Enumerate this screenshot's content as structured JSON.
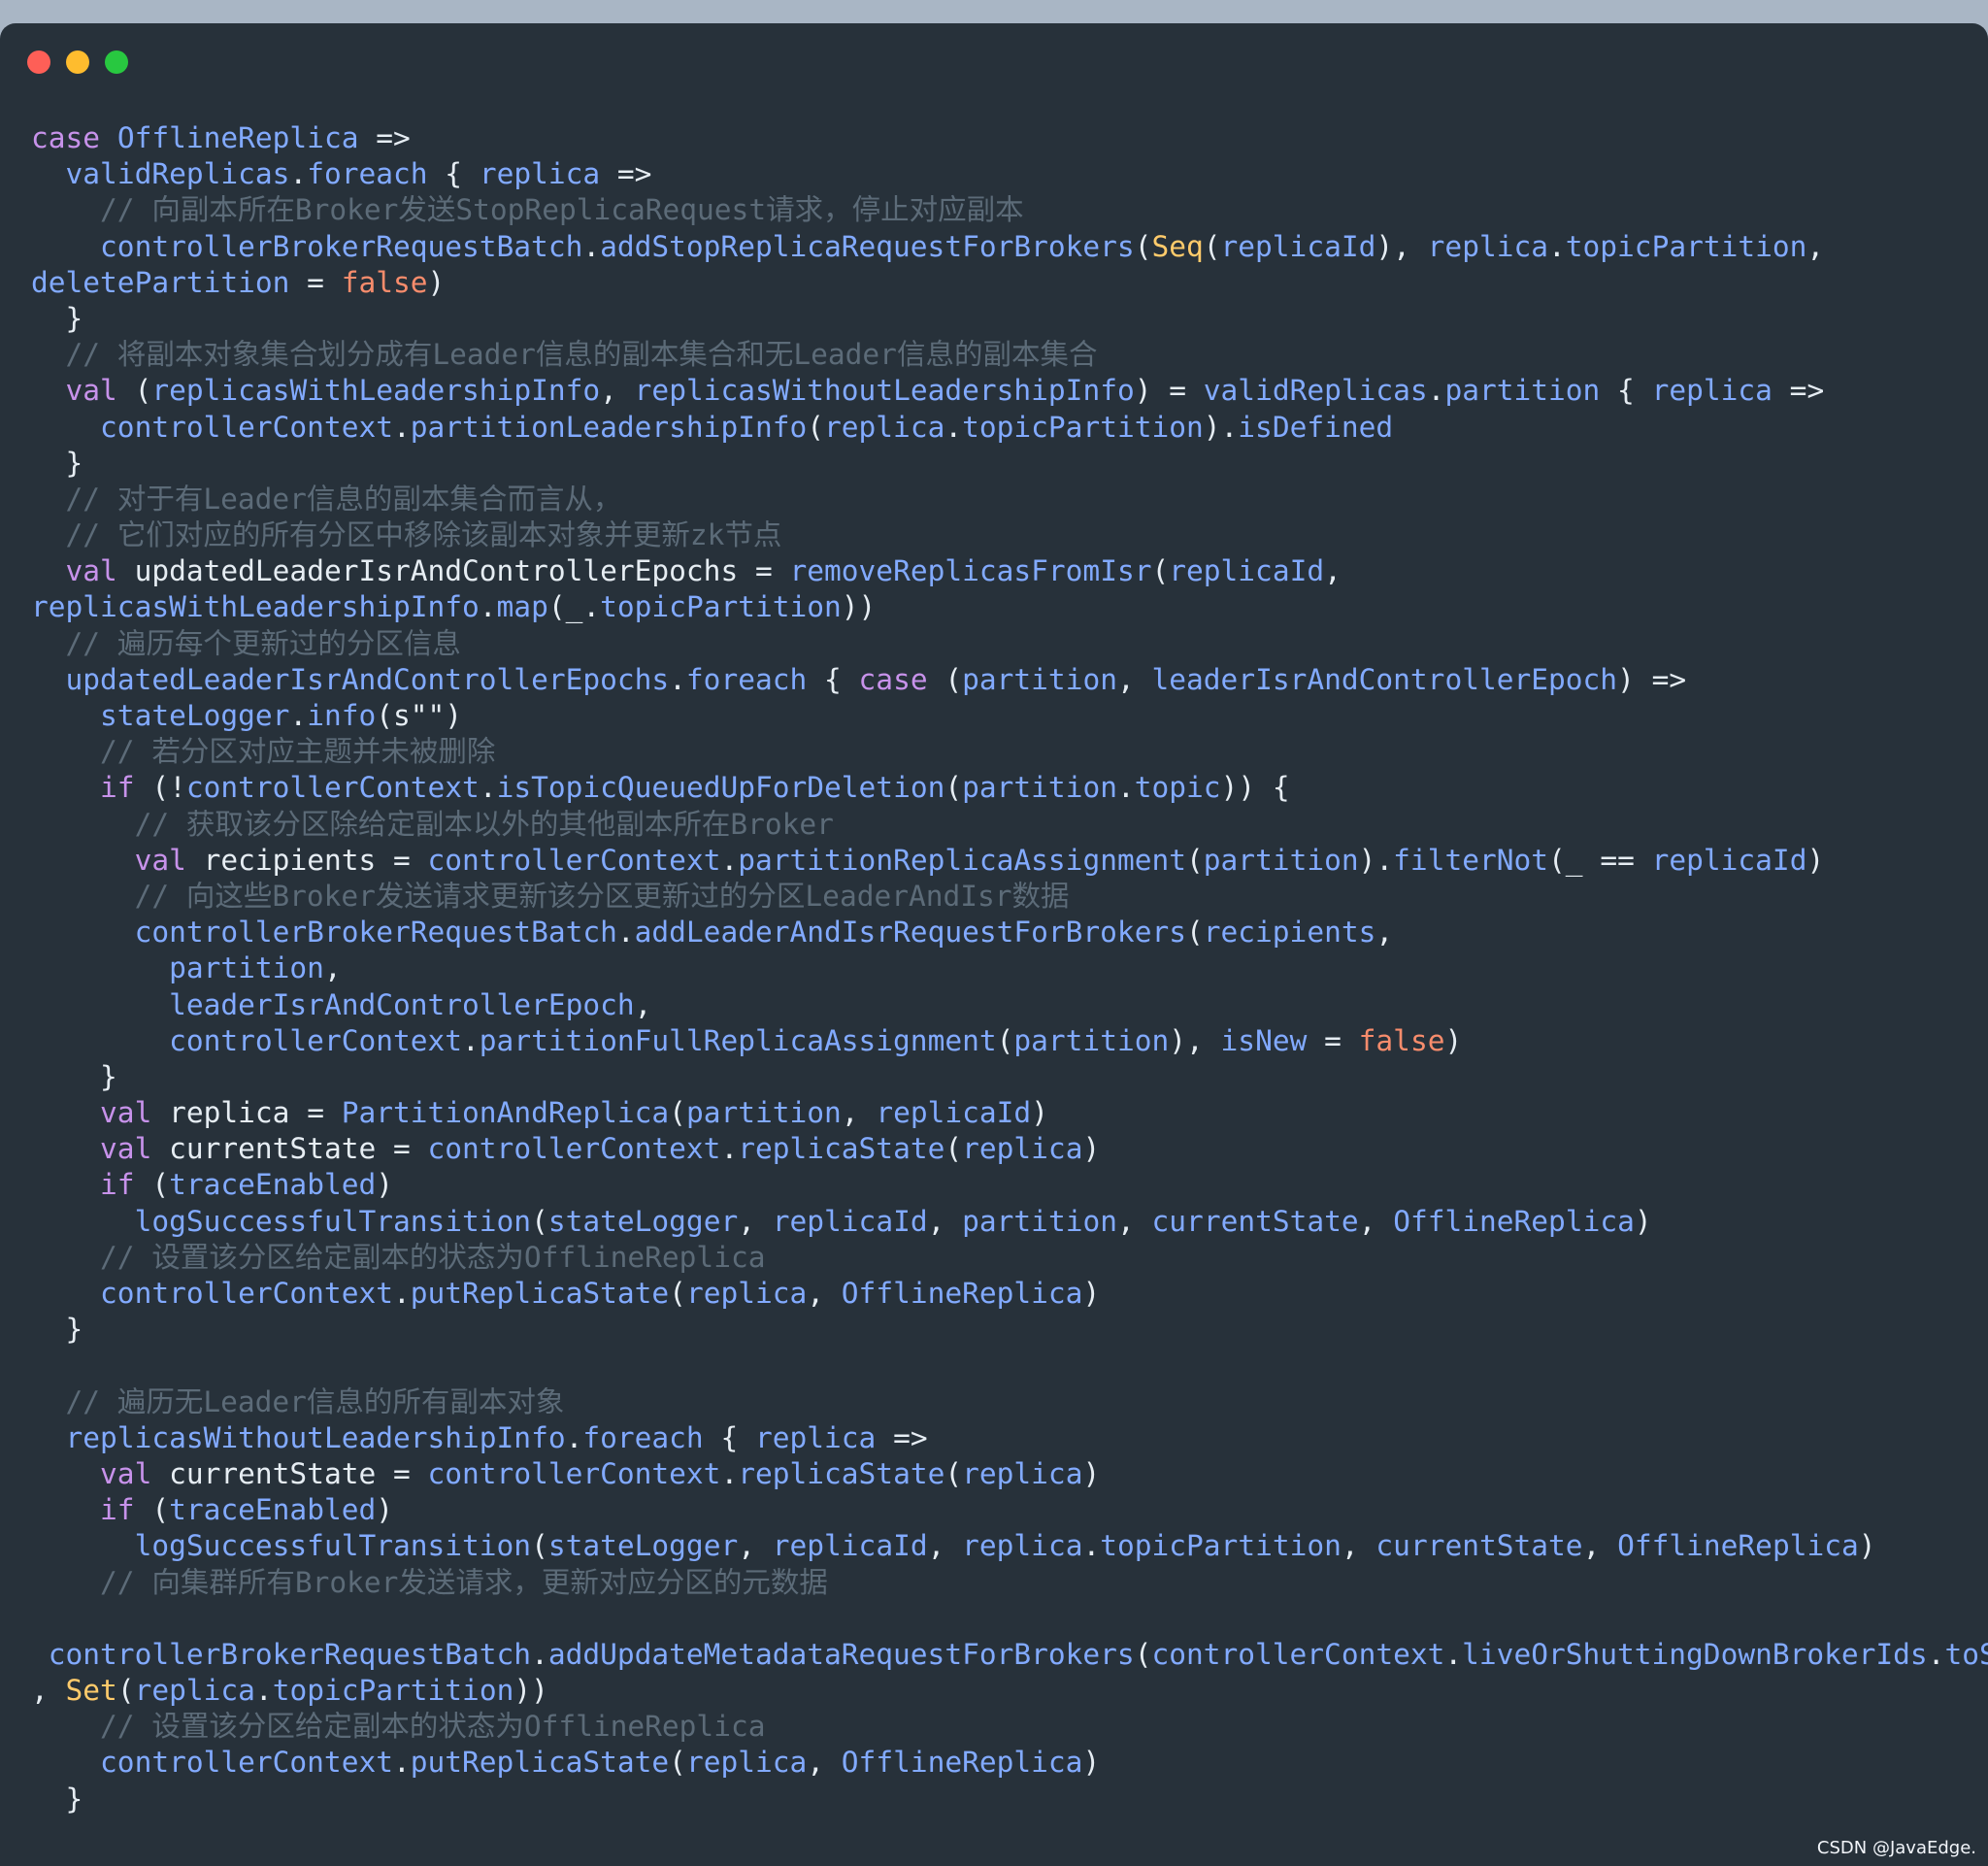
{
  "colors": {
    "plain": "#e6edf3",
    "keyword": "#c792ea",
    "ident": "#82aaff",
    "comment": "#5c6b78",
    "bool": "#f78c6c",
    "type": "#ffcb6b"
  },
  "window": {
    "controls": [
      {
        "name": "close-button",
        "color": "#fe5f57"
      },
      {
        "name": "minimize-button",
        "color": "#febc2e"
      },
      {
        "name": "maximize-button",
        "color": "#28c840"
      }
    ]
  },
  "code": {
    "lines": [
      [
        [
          "k",
          "case "
        ],
        [
          "i",
          "OfflineReplica"
        ],
        [
          "p",
          " =>"
        ]
      ],
      [
        [
          "p",
          "  "
        ],
        [
          "i",
          "validReplicas"
        ],
        [
          "p",
          "."
        ],
        [
          "i",
          "foreach"
        ],
        [
          "p",
          " { "
        ],
        [
          "i",
          "replica"
        ],
        [
          "p",
          " =>"
        ]
      ],
      [
        [
          "p",
          "    "
        ],
        [
          "c",
          "// 向副本所在Broker发送StopReplicaRequest请求，停止对应副本"
        ]
      ],
      [
        [
          "p",
          "    "
        ],
        [
          "i",
          "controllerBrokerRequestBatch"
        ],
        [
          "p",
          "."
        ],
        [
          "i",
          "addStopReplicaRequestForBrokers"
        ],
        [
          "p",
          "("
        ],
        [
          "t",
          "Seq"
        ],
        [
          "p",
          "("
        ],
        [
          "i",
          "replicaId"
        ],
        [
          "p",
          "), "
        ],
        [
          "i",
          "replica"
        ],
        [
          "p",
          "."
        ],
        [
          "i",
          "topicPartition"
        ],
        [
          "p",
          ","
        ]
      ],
      [
        [
          "i",
          "deletePartition"
        ],
        [
          "p",
          " = "
        ],
        [
          "b",
          "false"
        ],
        [
          "p",
          ")"
        ]
      ],
      [
        [
          "p",
          "  }"
        ]
      ],
      [
        [
          "p",
          "  "
        ],
        [
          "c",
          "// 将副本对象集合划分成有Leader信息的副本集合和无Leader信息的副本集合"
        ]
      ],
      [
        [
          "p",
          "  "
        ],
        [
          "k",
          "val"
        ],
        [
          "p",
          " ("
        ],
        [
          "i",
          "replicasWithLeadershipInfo"
        ],
        [
          "p",
          ", "
        ],
        [
          "i",
          "replicasWithoutLeadershipInfo"
        ],
        [
          "p",
          ") = "
        ],
        [
          "i",
          "validReplicas"
        ],
        [
          "p",
          "."
        ],
        [
          "i",
          "partition"
        ],
        [
          "p",
          " { "
        ],
        [
          "i",
          "replica"
        ],
        [
          "p",
          " =>"
        ]
      ],
      [
        [
          "p",
          "    "
        ],
        [
          "i",
          "controllerContext"
        ],
        [
          "p",
          "."
        ],
        [
          "i",
          "partitionLeadershipInfo"
        ],
        [
          "p",
          "("
        ],
        [
          "i",
          "replica"
        ],
        [
          "p",
          "."
        ],
        [
          "i",
          "topicPartition"
        ],
        [
          "p",
          ")."
        ],
        [
          "i",
          "isDefined"
        ]
      ],
      [
        [
          "p",
          "  }"
        ]
      ],
      [
        [
          "p",
          "  "
        ],
        [
          "c",
          "// 对于有Leader信息的副本集合而言从，"
        ]
      ],
      [
        [
          "p",
          "  "
        ],
        [
          "c",
          "// 它们对应的所有分区中移除该副本对象并更新zk节点"
        ]
      ],
      [
        [
          "p",
          "  "
        ],
        [
          "k",
          "val"
        ],
        [
          "p",
          " updatedLeaderIsrAndControllerEpochs = "
        ],
        [
          "i",
          "removeReplicasFromIsr"
        ],
        [
          "p",
          "("
        ],
        [
          "i",
          "replicaId"
        ],
        [
          "p",
          ","
        ]
      ],
      [
        [
          "i",
          "replicasWithLeadershipInfo"
        ],
        [
          "p",
          "."
        ],
        [
          "i",
          "map"
        ],
        [
          "p",
          "(_."
        ],
        [
          "i",
          "topicPartition"
        ],
        [
          "p",
          "))"
        ]
      ],
      [
        [
          "p",
          "  "
        ],
        [
          "c",
          "// 遍历每个更新过的分区信息"
        ]
      ],
      [
        [
          "p",
          "  "
        ],
        [
          "i",
          "updatedLeaderIsrAndControllerEpochs"
        ],
        [
          "p",
          "."
        ],
        [
          "i",
          "foreach"
        ],
        [
          "p",
          " { "
        ],
        [
          "k",
          "case"
        ],
        [
          "p",
          " ("
        ],
        [
          "i",
          "partition"
        ],
        [
          "p",
          ", "
        ],
        [
          "i",
          "leaderIsrAndControllerEpoch"
        ],
        [
          "p",
          ") =>"
        ]
      ],
      [
        [
          "p",
          "    "
        ],
        [
          "i",
          "stateLogger"
        ],
        [
          "p",
          "."
        ],
        [
          "i",
          "info"
        ],
        [
          "p",
          "(s\"\")"
        ]
      ],
      [
        [
          "p",
          "    "
        ],
        [
          "c",
          "// 若分区对应主题并未被删除"
        ]
      ],
      [
        [
          "p",
          "    "
        ],
        [
          "k",
          "if"
        ],
        [
          "p",
          " (!"
        ],
        [
          "i",
          "controllerContext"
        ],
        [
          "p",
          "."
        ],
        [
          "i",
          "isTopicQueuedUpForDeletion"
        ],
        [
          "p",
          "("
        ],
        [
          "i",
          "partition"
        ],
        [
          "p",
          "."
        ],
        [
          "i",
          "topic"
        ],
        [
          "p",
          ")) {"
        ]
      ],
      [
        [
          "p",
          "      "
        ],
        [
          "c",
          "// 获取该分区除给定副本以外的其他副本所在Broker"
        ]
      ],
      [
        [
          "p",
          "      "
        ],
        [
          "k",
          "val"
        ],
        [
          "p",
          " recipients = "
        ],
        [
          "i",
          "controllerContext"
        ],
        [
          "p",
          "."
        ],
        [
          "i",
          "partitionReplicaAssignment"
        ],
        [
          "p",
          "("
        ],
        [
          "i",
          "partition"
        ],
        [
          "p",
          ")."
        ],
        [
          "i",
          "filterNot"
        ],
        [
          "p",
          "(_ == "
        ],
        [
          "i",
          "replicaId"
        ],
        [
          "p",
          ")"
        ]
      ],
      [
        [
          "p",
          "      "
        ],
        [
          "c",
          "// 向这些Broker发送请求更新该分区更新过的分区LeaderAndIsr数据"
        ]
      ],
      [
        [
          "p",
          "      "
        ],
        [
          "i",
          "controllerBrokerRequestBatch"
        ],
        [
          "p",
          "."
        ],
        [
          "i",
          "addLeaderAndIsrRequestForBrokers"
        ],
        [
          "p",
          "("
        ],
        [
          "i",
          "recipients"
        ],
        [
          "p",
          ","
        ]
      ],
      [
        [
          "p",
          "        "
        ],
        [
          "i",
          "partition"
        ],
        [
          "p",
          ","
        ]
      ],
      [
        [
          "p",
          "        "
        ],
        [
          "i",
          "leaderIsrAndControllerEpoch"
        ],
        [
          "p",
          ","
        ]
      ],
      [
        [
          "p",
          "        "
        ],
        [
          "i",
          "controllerContext"
        ],
        [
          "p",
          "."
        ],
        [
          "i",
          "partitionFullReplicaAssignment"
        ],
        [
          "p",
          "("
        ],
        [
          "i",
          "partition"
        ],
        [
          "p",
          "), "
        ],
        [
          "i",
          "isNew"
        ],
        [
          "p",
          " = "
        ],
        [
          "b",
          "false"
        ],
        [
          "p",
          ")"
        ]
      ],
      [
        [
          "p",
          "    }"
        ]
      ],
      [
        [
          "p",
          "    "
        ],
        [
          "k",
          "val"
        ],
        [
          "p",
          " replica = "
        ],
        [
          "i",
          "PartitionAndReplica"
        ],
        [
          "p",
          "("
        ],
        [
          "i",
          "partition"
        ],
        [
          "p",
          ", "
        ],
        [
          "i",
          "replicaId"
        ],
        [
          "p",
          ")"
        ]
      ],
      [
        [
          "p",
          "    "
        ],
        [
          "k",
          "val"
        ],
        [
          "p",
          " currentState = "
        ],
        [
          "i",
          "controllerContext"
        ],
        [
          "p",
          "."
        ],
        [
          "i",
          "replicaState"
        ],
        [
          "p",
          "("
        ],
        [
          "i",
          "replica"
        ],
        [
          "p",
          ")"
        ]
      ],
      [
        [
          "p",
          "    "
        ],
        [
          "k",
          "if"
        ],
        [
          "p",
          " ("
        ],
        [
          "i",
          "traceEnabled"
        ],
        [
          "p",
          ")"
        ]
      ],
      [
        [
          "p",
          "      "
        ],
        [
          "i",
          "logSuccessfulTransition"
        ],
        [
          "p",
          "("
        ],
        [
          "i",
          "stateLogger"
        ],
        [
          "p",
          ", "
        ],
        [
          "i",
          "replicaId"
        ],
        [
          "p",
          ", "
        ],
        [
          "i",
          "partition"
        ],
        [
          "p",
          ", "
        ],
        [
          "i",
          "currentState"
        ],
        [
          "p",
          ", "
        ],
        [
          "i",
          "OfflineReplica"
        ],
        [
          "p",
          ")"
        ]
      ],
      [
        [
          "p",
          "    "
        ],
        [
          "c",
          "// 设置该分区给定副本的状态为OfflineReplica"
        ]
      ],
      [
        [
          "p",
          "    "
        ],
        [
          "i",
          "controllerContext"
        ],
        [
          "p",
          "."
        ],
        [
          "i",
          "putReplicaState"
        ],
        [
          "p",
          "("
        ],
        [
          "i",
          "replica"
        ],
        [
          "p",
          ", "
        ],
        [
          "i",
          "OfflineReplica"
        ],
        [
          "p",
          ")"
        ]
      ],
      [
        [
          "p",
          "  }"
        ]
      ],
      [
        [
          "p",
          ""
        ]
      ],
      [
        [
          "p",
          "  "
        ],
        [
          "c",
          "// 遍历无Leader信息的所有副本对象"
        ]
      ],
      [
        [
          "p",
          "  "
        ],
        [
          "i",
          "replicasWithoutLeadershipInfo"
        ],
        [
          "p",
          "."
        ],
        [
          "i",
          "foreach"
        ],
        [
          "p",
          " { "
        ],
        [
          "i",
          "replica"
        ],
        [
          "p",
          " =>"
        ]
      ],
      [
        [
          "p",
          "    "
        ],
        [
          "k",
          "val"
        ],
        [
          "p",
          " currentState = "
        ],
        [
          "i",
          "controllerContext"
        ],
        [
          "p",
          "."
        ],
        [
          "i",
          "replicaState"
        ],
        [
          "p",
          "("
        ],
        [
          "i",
          "replica"
        ],
        [
          "p",
          ")"
        ]
      ],
      [
        [
          "p",
          "    "
        ],
        [
          "k",
          "if"
        ],
        [
          "p",
          " ("
        ],
        [
          "i",
          "traceEnabled"
        ],
        [
          "p",
          ")"
        ]
      ],
      [
        [
          "p",
          "      "
        ],
        [
          "i",
          "logSuccessfulTransition"
        ],
        [
          "p",
          "("
        ],
        [
          "i",
          "stateLogger"
        ],
        [
          "p",
          ", "
        ],
        [
          "i",
          "replicaId"
        ],
        [
          "p",
          ", "
        ],
        [
          "i",
          "replica"
        ],
        [
          "p",
          "."
        ],
        [
          "i",
          "topicPartition"
        ],
        [
          "p",
          ", "
        ],
        [
          "i",
          "currentState"
        ],
        [
          "p",
          ", "
        ],
        [
          "i",
          "OfflineReplica"
        ],
        [
          "p",
          ")"
        ]
      ],
      [
        [
          "p",
          "    "
        ],
        [
          "c",
          "// 向集群所有Broker发送请求，更新对应分区的元数据"
        ]
      ],
      [
        [
          "p",
          ""
        ]
      ],
      [
        [
          "p",
          " "
        ],
        [
          "i",
          "controllerBrokerRequestBatch"
        ],
        [
          "p",
          "."
        ],
        [
          "i",
          "addUpdateMetadataRequestForBrokers"
        ],
        [
          "p",
          "("
        ],
        [
          "i",
          "controllerContext"
        ],
        [
          "p",
          "."
        ],
        [
          "i",
          "liveOrShuttingDownBrokerIds"
        ],
        [
          "p",
          "."
        ],
        [
          "i",
          "toSeq"
        ]
      ],
      [
        [
          "p",
          ", "
        ],
        [
          "t",
          "Set"
        ],
        [
          "p",
          "("
        ],
        [
          "i",
          "replica"
        ],
        [
          "p",
          "."
        ],
        [
          "i",
          "topicPartition"
        ],
        [
          "p",
          "))"
        ]
      ],
      [
        [
          "p",
          "    "
        ],
        [
          "c",
          "// 设置该分区给定副本的状态为OfflineReplica"
        ]
      ],
      [
        [
          "p",
          "    "
        ],
        [
          "i",
          "controllerContext"
        ],
        [
          "p",
          "."
        ],
        [
          "i",
          "putReplicaState"
        ],
        [
          "p",
          "("
        ],
        [
          "i",
          "replica"
        ],
        [
          "p",
          ", "
        ],
        [
          "i",
          "OfflineReplica"
        ],
        [
          "p",
          ")"
        ]
      ],
      [
        [
          "p",
          "  }"
        ]
      ]
    ]
  },
  "watermark": "CSDN @JavaEdge."
}
